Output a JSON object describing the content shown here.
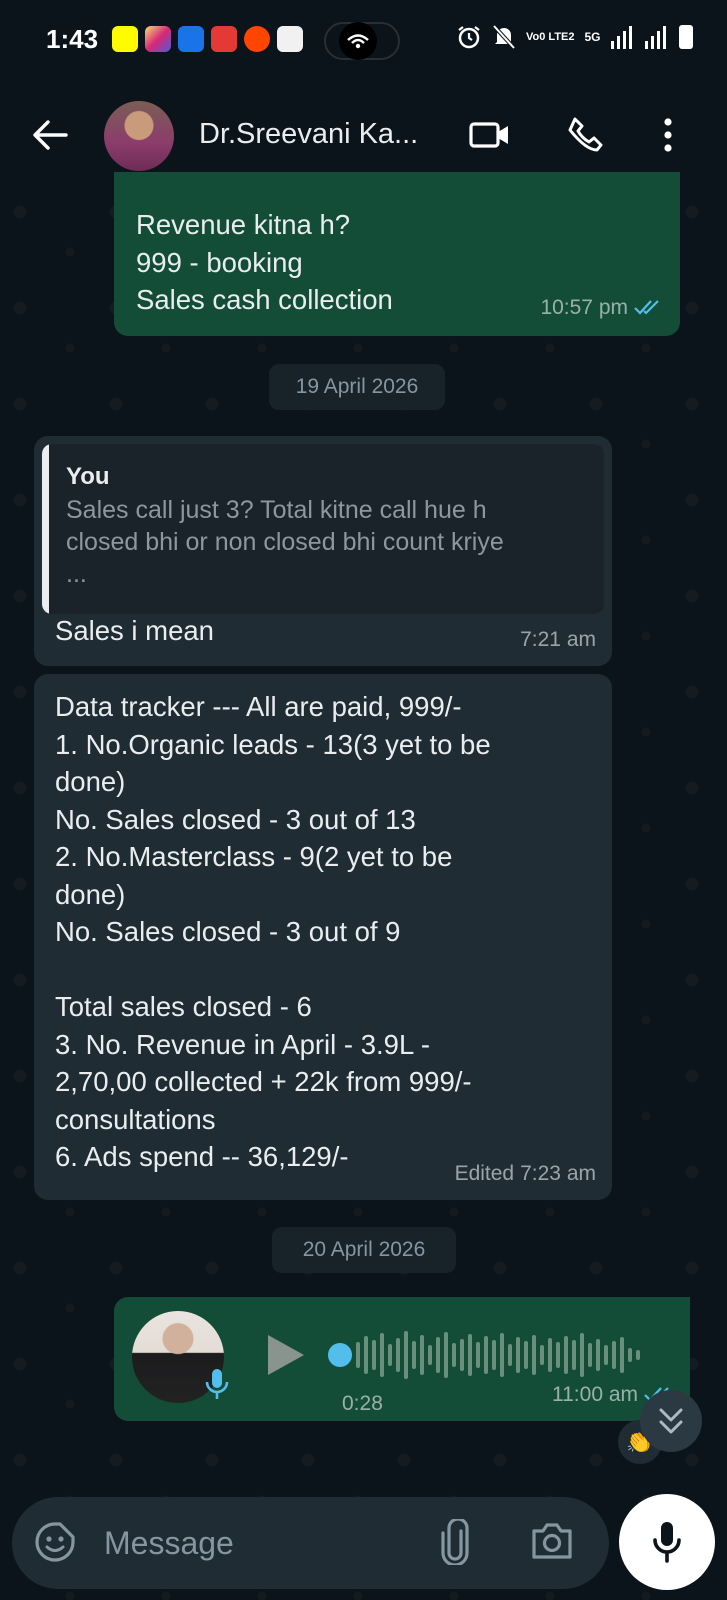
{
  "status_bar": {
    "time": "1:43",
    "network": "Vo0 LTE2",
    "network_type": "5G"
  },
  "header": {
    "contact_name": "Dr.Sreevani Ka...",
    "icons": [
      "back-arrow-icon",
      "video-call-icon",
      "voice-call-icon",
      "more-options-icon"
    ]
  },
  "messages": [
    {
      "direction": "out",
      "text": "Revenue kitna h?\n999 - booking\nSales cash collection",
      "time": "10:57 pm",
      "status": "read"
    },
    {
      "date_chip": "19 April 2026"
    },
    {
      "direction": "in",
      "quote_author": "You",
      "quote_text": "Sales call just 3? Total kitne call hue h\nclosed bhi or non closed bhi count kriye\n...",
      "text": "Sales i mean",
      "time": "7:21 am"
    },
    {
      "direction": "in",
      "text": "Data tracker --- All are paid, 999/-\n1. No.Organic leads - 13(3 yet to be\ndone)\nNo. Sales closed - 3 out of 13\n2. No.Masterclass - 9(2 yet to be\ndone)\nNo. Sales closed - 3 out of 9\n\nTotal sales closed - 6\n3. No. Revenue in April - 3.9L -\n2,70,00 collected + 22k from 999/-\nconsultations\n6. Ads spend -- 36,129/-",
      "edited_label": "Edited",
      "time": "7:23 am"
    },
    {
      "date_chip": "20 April 2026"
    },
    {
      "direction": "out",
      "type": "voice_note",
      "duration": "0:28",
      "time": "11:00 am",
      "status": "read"
    }
  ],
  "reaction": "👏",
  "composer": {
    "placeholder": "Message"
  },
  "colors": {
    "background": "#0b141a",
    "outgoing_bubble": "#144d37",
    "incoming_bubble": "#1f2c34",
    "read_ticks": "#53bdeb"
  }
}
